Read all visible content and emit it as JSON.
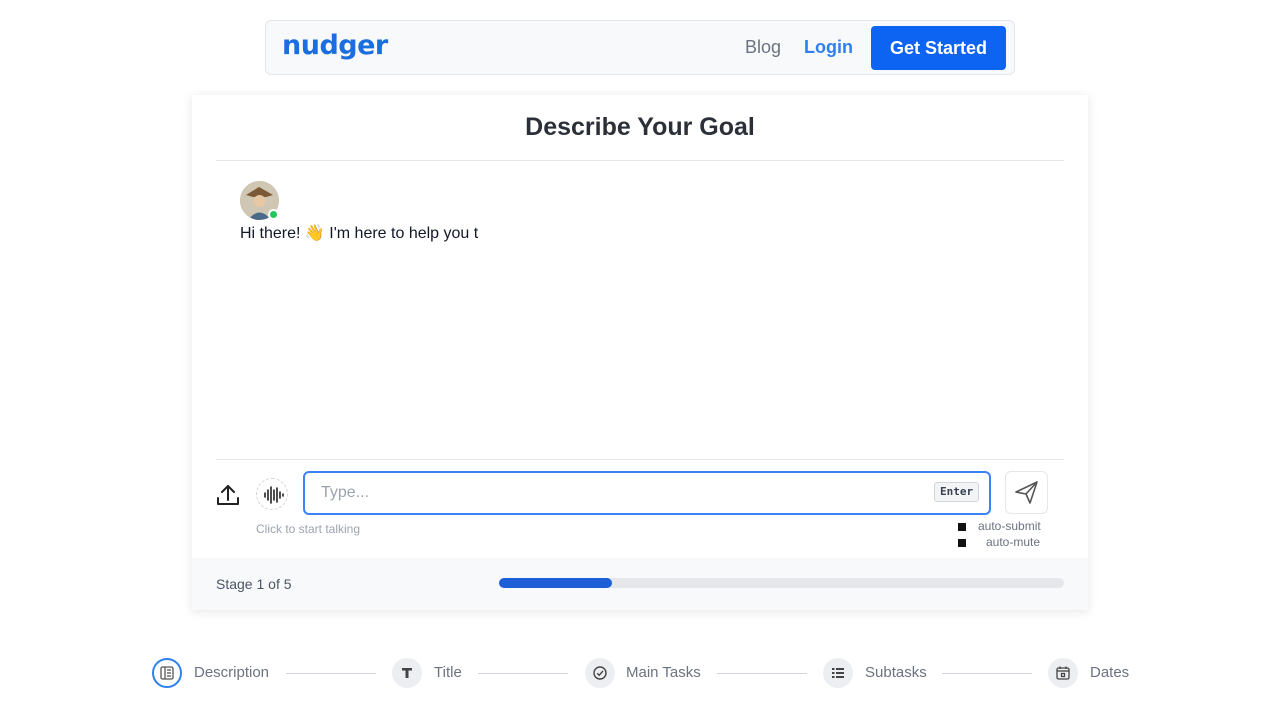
{
  "header": {
    "logo": "nudger",
    "blog_label": "Blog",
    "login_label": "Login",
    "cta_label": "Get Started"
  },
  "card": {
    "title": "Describe Your Goal",
    "message": "Hi there! 👋 I'm here to help you t"
  },
  "input": {
    "placeholder": "Type...",
    "enter_hint": "Enter",
    "mic_hint": "Click to start talking"
  },
  "options": {
    "auto_submit": "auto-submit",
    "auto_mute": "auto-mute"
  },
  "stage": {
    "text": "Stage 1 of 5",
    "progress": 0.2
  },
  "steps": [
    {
      "label": "Description",
      "icon": "document-icon"
    },
    {
      "label": "Title",
      "icon": "text-icon"
    },
    {
      "label": "Main Tasks",
      "icon": "check-circle-icon"
    },
    {
      "label": "Subtasks",
      "icon": "list-icon"
    },
    {
      "label": "Dates",
      "icon": "calendar-icon"
    }
  ],
  "colors": {
    "brand": "#1a6ee0",
    "cta": "#0d63f2",
    "progress": "#1e5fd8",
    "online": "#22c55e"
  }
}
